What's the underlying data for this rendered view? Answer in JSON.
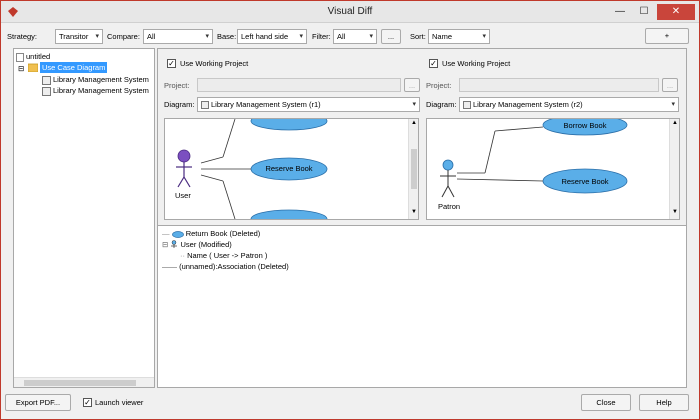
{
  "window": {
    "title": "Visual Diff",
    "minimize": "—",
    "maximize": "☐",
    "close": "✕"
  },
  "toolbar": {
    "strategy_label": "Strategy:",
    "strategy_value": "Transitor",
    "compare_label": "Compare:",
    "compare_value": "All",
    "base_label": "Base:",
    "base_value": "Left hand side",
    "filter_label": "Filter:",
    "filter_value": "All",
    "more_button": "...",
    "sort_label": "Sort:",
    "sort_value": "Name",
    "add_button": "+"
  },
  "tree": {
    "root": "untitled",
    "diagram": "Use Case Diagram",
    "items": [
      "Library Management System",
      "Library Management System"
    ]
  },
  "left": {
    "use_working": "Use Working Project",
    "project_label": "Project:",
    "project_more": "...",
    "diagram_label": "Diagram:",
    "diagram_value": "Library Management System (r1)",
    "actor": "User",
    "usecase_mid": "Reserve Book"
  },
  "right": {
    "use_working": "Use Working Project",
    "project_label": "Project:",
    "project_more": "...",
    "diagram_label": "Diagram:",
    "diagram_value": "Library Management System (r2)",
    "actor": "Patron",
    "usecase_top": "Borrow Book",
    "usecase_mid": "Reserve Book"
  },
  "diff": {
    "items": [
      "Return Book (Deleted)",
      "User (Modified)",
      "Name ( User -> Patron )",
      "(unnamed):Association (Deleted)"
    ]
  },
  "bottom": {
    "export_pdf": "Export PDF...",
    "launch_viewer": "Launch viewer",
    "close": "Close",
    "help": "Help"
  },
  "colors": {
    "usecase_fill": "#5aaee8",
    "actor": "#6a3fb0",
    "selection": "#3399ff"
  }
}
